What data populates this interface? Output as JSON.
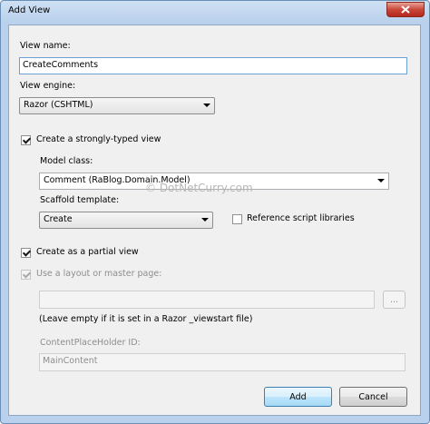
{
  "window": {
    "title": "Add View"
  },
  "form": {
    "view_name_label": "View name:",
    "view_name_value": "CreateComments",
    "view_engine_label": "View engine:",
    "view_engine_value": "Razor (CSHTML)",
    "strongly_typed_label": "Create a strongly-typed view",
    "strongly_typed_checked": true,
    "model_class_label": "Model class:",
    "model_class_value": "Comment (RaBlog.Domain.Model)",
    "scaffold_label": "Scaffold template:",
    "scaffold_value": "Create",
    "reference_scripts_label": "Reference script libraries",
    "reference_scripts_checked": false,
    "partial_view_label": "Create as a partial view",
    "partial_view_checked": true,
    "use_layout_label": "Use a layout or master page:",
    "use_layout_checked": true,
    "layout_path_value": "",
    "browse_label": "...",
    "leave_empty_note": "(Leave empty if it is set in a Razor _viewstart file)",
    "placeholder_id_label": "ContentPlaceHolder ID:",
    "placeholder_id_value": "MainContent"
  },
  "buttons": {
    "add": "Add",
    "cancel": "Cancel"
  },
  "watermark": "© DotNetCurry.com"
}
